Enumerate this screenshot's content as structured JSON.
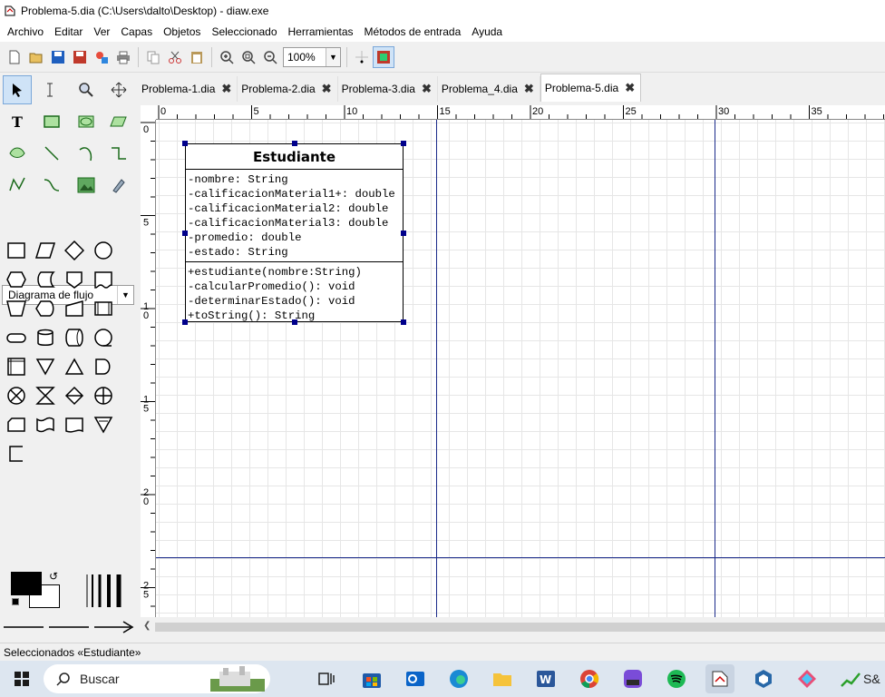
{
  "window": {
    "title": "Problema-5.dia (C:\\Users\\dalto\\Desktop) - diaw.exe"
  },
  "menu": [
    "Archivo",
    "Editar",
    "Ver",
    "Capas",
    "Objetos",
    "Seleccionado",
    "Herramientas",
    "Métodos de entrada",
    "Ayuda"
  ],
  "toolbar": {
    "zoom": "100%"
  },
  "sheet_selector": "Diagrama de flujo",
  "tabs": [
    {
      "label": "Problema-1.dia",
      "active": false
    },
    {
      "label": "Problema-2.dia",
      "active": false
    },
    {
      "label": "Problema-3.dia",
      "active": false
    },
    {
      "label": "Problema_4.dia",
      "active": false
    },
    {
      "label": "Problema-5.dia",
      "active": true
    }
  ],
  "ruler": {
    "h_labels": [
      "0",
      "5",
      "10",
      "15",
      "20",
      "25",
      "30",
      "35"
    ],
    "v_labels": [
      "0",
      "5",
      "10",
      "15",
      "20",
      "25"
    ]
  },
  "uml": {
    "name": "Estudiante",
    "attributes": [
      "-nombre: String",
      "-calificacionMaterial1+: double",
      "-calificacionMaterial2: double",
      "-calificacionMaterial3: double",
      "-promedio: double",
      "-estado: String"
    ],
    "operations": [
      "+estudiante(nombre:String)",
      "-calcularPromedio(): void",
      "-determinarEstado(): void",
      "+toString(): String"
    ]
  },
  "status": "Seleccionados «Estudiante»",
  "taskbar": {
    "search_placeholder": "Buscar",
    "tray_label": "S&"
  },
  "colors": {
    "selection": "#cfe3f7",
    "guide_line": "#1a2a8a",
    "handle": "#00008b"
  }
}
